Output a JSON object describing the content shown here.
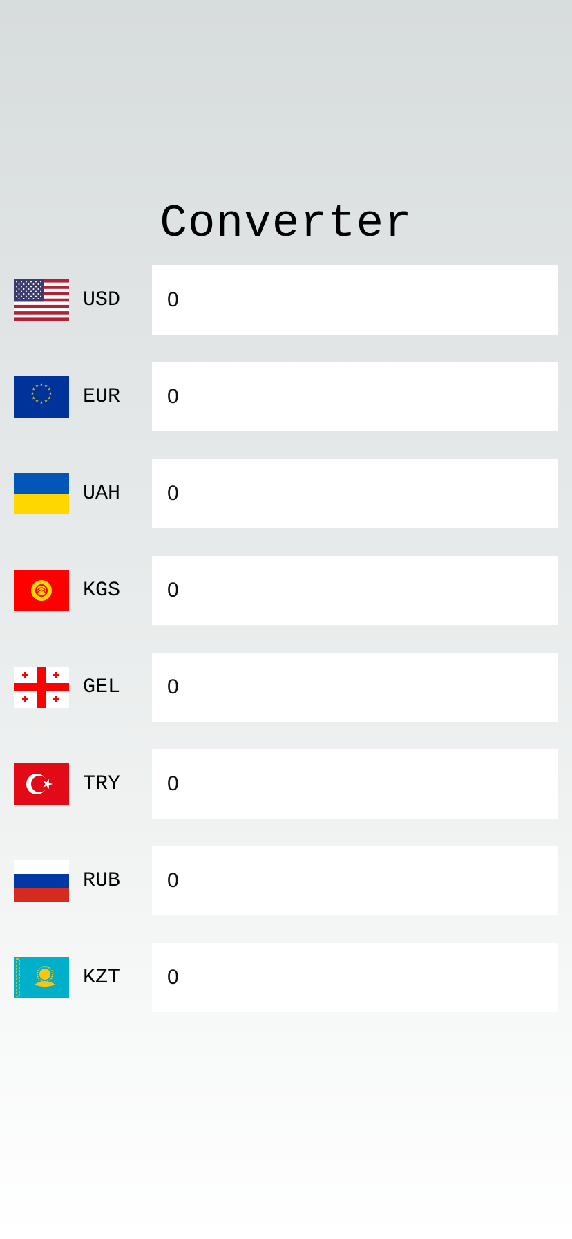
{
  "app": {
    "title": "Converter"
  },
  "currencies": [
    {
      "code": "USD",
      "value": "0",
      "flag_icon": "us-flag-icon"
    },
    {
      "code": "EUR",
      "value": "0",
      "flag_icon": "eu-flag-icon"
    },
    {
      "code": "UAH",
      "value": "0",
      "flag_icon": "ukraine-flag-icon"
    },
    {
      "code": "KGS",
      "value": "0",
      "flag_icon": "kyrgyzstan-flag-icon"
    },
    {
      "code": "GEL",
      "value": "0",
      "flag_icon": "georgia-flag-icon"
    },
    {
      "code": "TRY",
      "value": "0",
      "flag_icon": "turkey-flag-icon"
    },
    {
      "code": "RUB",
      "value": "0",
      "flag_icon": "russia-flag-icon"
    },
    {
      "code": "KZT",
      "value": "0",
      "flag_icon": "kazakhstan-flag-icon"
    }
  ],
  "colors": {
    "background_top": "#d7dcdc",
    "background_bottom": "#ffffff",
    "input_background": "#ffffff",
    "text": "#000000"
  }
}
